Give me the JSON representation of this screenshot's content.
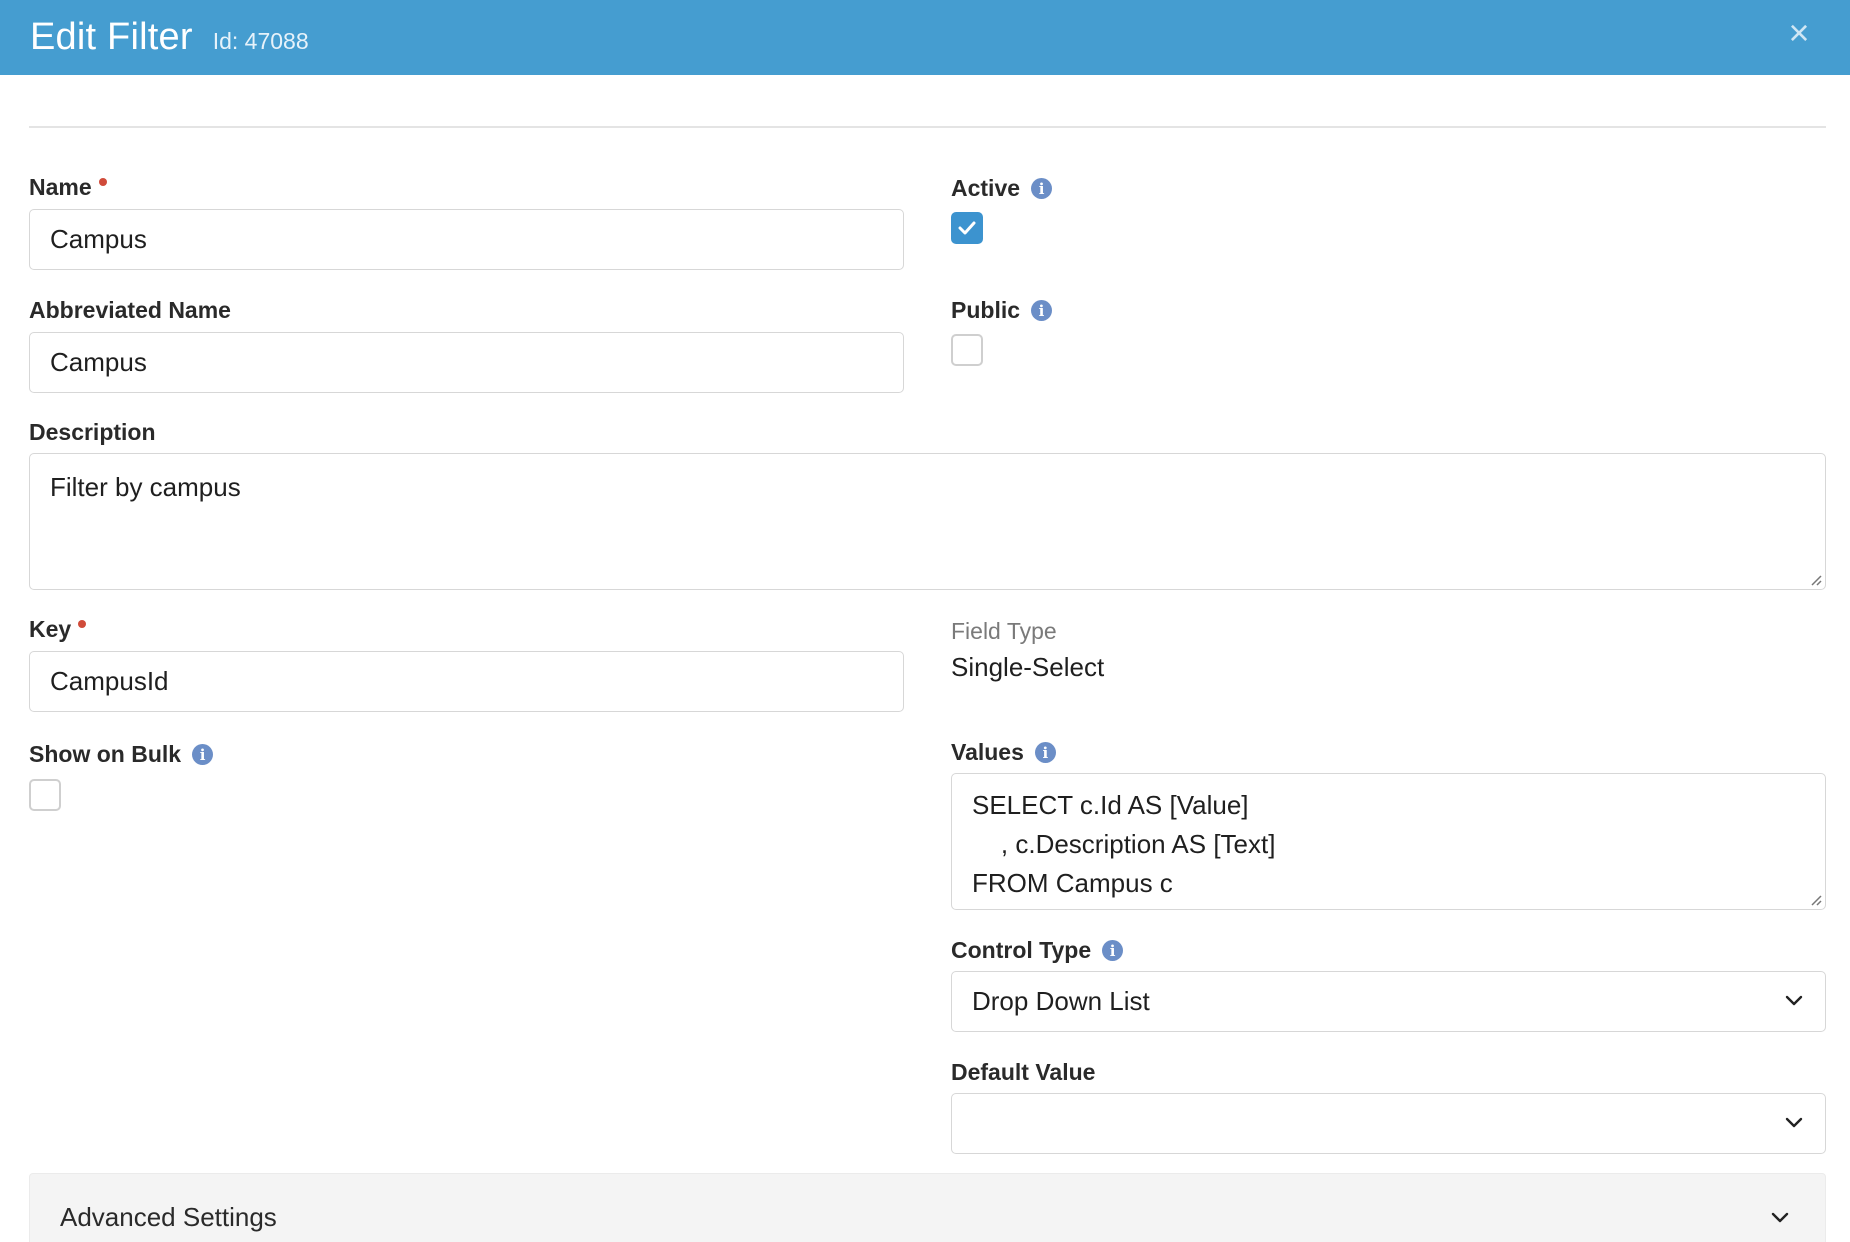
{
  "header": {
    "title": "Edit Filter",
    "id_text": "Id: 47088",
    "close_glyph": "×",
    "background": "#459dd0"
  },
  "fields": {
    "name": {
      "label": "Name",
      "value": "Campus",
      "required": true
    },
    "abbreviated_name": {
      "label": "Abbreviated Name",
      "value": "Campus"
    },
    "description": {
      "label": "Description",
      "value": "Filter by campus"
    },
    "key": {
      "label": "Key",
      "value": "CampusId",
      "required": true
    },
    "show_on_bulk": {
      "label": "Show on Bulk",
      "checked": false
    },
    "active": {
      "label": "Active",
      "checked": true
    },
    "public": {
      "label": "Public",
      "checked": false
    },
    "field_type": {
      "label": "Field Type",
      "value": "Single-Select"
    },
    "values": {
      "label": "Values",
      "lines": [
        "SELECT c.Id AS [Value]",
        "    , c.Description AS [Text]",
        "FROM Campus c"
      ]
    },
    "control_type": {
      "label": "Control Type",
      "value": "Drop Down List"
    },
    "default_value": {
      "label": "Default Value",
      "value": ""
    }
  },
  "advanced_settings": {
    "label": "Advanced Settings"
  },
  "icons": {
    "info": "info-icon",
    "close": "close-icon",
    "check": "check-icon",
    "chevron": "chevron-down-icon"
  },
  "colors": {
    "accent": "#3c93cf",
    "required_dot": "#d04b3a",
    "info_icon": "#6b8ec7"
  }
}
